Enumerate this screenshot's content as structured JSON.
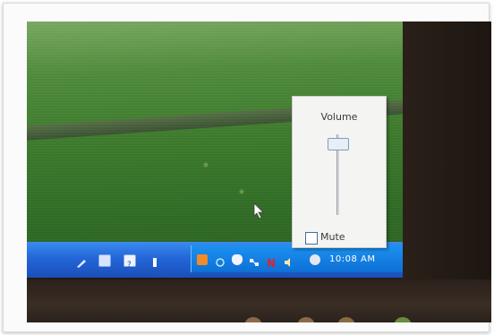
{
  "volume_popup": {
    "title": "Volume",
    "mute_label": "Mute",
    "mute_checked": false,
    "volume_level_fraction": 0.88
  },
  "taskbar": {
    "clock": "10:08 AM",
    "quick_launch_icons": [
      "pen-icon",
      "display-icon",
      "help-icon",
      "usb-icon"
    ],
    "tray_icons": [
      "orange-app-icon",
      "refresh-icon",
      "shield-icon",
      "network-icon",
      "norton-icon",
      "speaker-icon",
      "printer-icon"
    ]
  },
  "colors": {
    "taskbar_blue": "#2466d8",
    "tray_blue": "#0e6fd6",
    "popup_bg": "#f4f4f2"
  }
}
